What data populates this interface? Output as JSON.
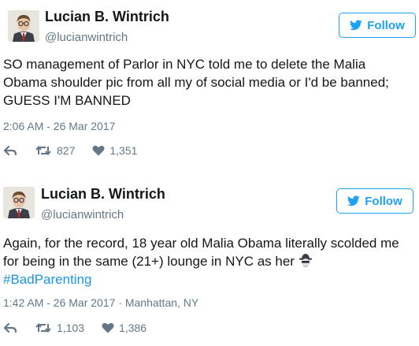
{
  "tweets": [
    {
      "author": {
        "name": "Lucian B. Wintrich",
        "handle": "@lucianwintrich"
      },
      "follow_label": "Follow",
      "text_lines": [
        "SO management of Parlor in NYC told me to delete the Malia",
        "Obama shoulder pic from all my of social media or I'd be banned;",
        "GUESS I'M BANNED"
      ],
      "timestamp": "2:06 AM - 26 Mar 2017",
      "retweets": "827",
      "likes": "1,351"
    },
    {
      "author": {
        "name": "Lucian B. Wintrich",
        "handle": "@lucianwintrich"
      },
      "follow_label": "Follow",
      "text_lines": [
        "Again, for the record, 18 year old Malia Obama literally scolded me",
        "for being in the same (21+) lounge in NYC as her"
      ],
      "hashtag": "#BadParenting",
      "timestamp": "1:42 AM - 26 Mar 2017 · Manhattan, NY",
      "retweets": "1,103",
      "likes": "1,386"
    }
  ],
  "colors": {
    "twitter_blue": "#1da1f2",
    "link": "#1b95e0",
    "muted": "#657786",
    "text": "#14171a"
  },
  "icons": [
    "twitter-bird-icon",
    "reply-icon",
    "retweet-icon",
    "heart-icon",
    "spy-emoji-icon"
  ]
}
